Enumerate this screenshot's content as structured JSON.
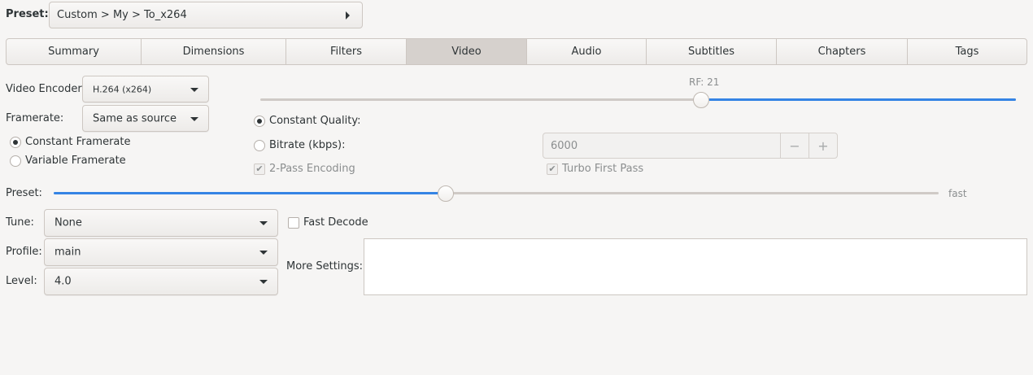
{
  "preset": {
    "label": "Preset:",
    "value": "Custom > My > To_x264"
  },
  "tabs": [
    {
      "label": "Summary"
    },
    {
      "label": "Dimensions"
    },
    {
      "label": "Filters"
    },
    {
      "label": "Video",
      "active": true
    },
    {
      "label": "Audio"
    },
    {
      "label": "Subtitles"
    },
    {
      "label": "Chapters"
    },
    {
      "label": "Tags"
    }
  ],
  "video": {
    "encoder_label": "Video Encoder:",
    "encoder_value": "H.264 (x264)",
    "framerate_label": "Framerate:",
    "framerate_value": "Same as source",
    "constant_framerate": "Constant Framerate",
    "variable_framerate": "Variable Framerate",
    "framerate_mode": "constant"
  },
  "quality": {
    "rf_label": "RF: 21",
    "rf_slider_fraction": 0.583,
    "constant_quality": "Constant Quality:",
    "bitrate_label": "Bitrate (kbps):",
    "bitrate_value": "6000",
    "minus": "−",
    "plus": "+",
    "two_pass": "2-Pass Encoding",
    "two_pass_checked": true,
    "turbo": "Turbo First Pass",
    "turbo_checked": true,
    "mode": "constant_quality"
  },
  "encoder_preset": {
    "label": "Preset:",
    "value_text": "fast",
    "slider_fraction": 0.443
  },
  "tune": {
    "label": "Tune:",
    "value": "None"
  },
  "fast_decode": {
    "label": "Fast Decode",
    "checked": false
  },
  "profile": {
    "label": "Profile:",
    "value": "main"
  },
  "level": {
    "label": "Level:",
    "value": "4.0"
  },
  "more_settings": {
    "label": "More Settings:",
    "value": ""
  },
  "colors": {
    "accent": "#3584e4",
    "bg": "#f6f5f4",
    "active_tab": "#d6d1cd"
  }
}
